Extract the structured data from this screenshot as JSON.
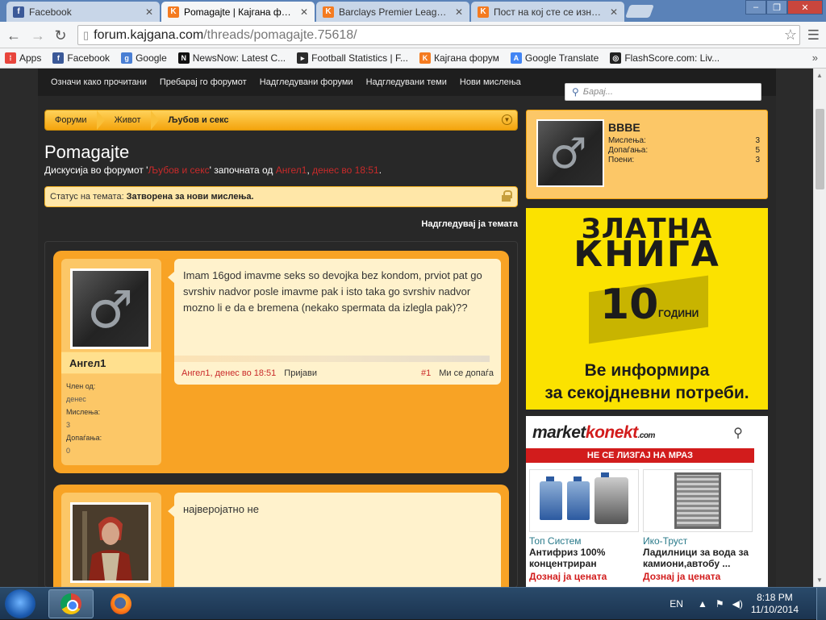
{
  "browser": {
    "tabs": [
      {
        "label": "Facebook",
        "icon": "facebook-icon",
        "color": "#3b5998",
        "glyph": "f"
      },
      {
        "label": "Pomagajte | Кајгана фору",
        "icon": "kajgana-icon",
        "color": "#f47b20",
        "glyph": "K"
      },
      {
        "label": "Barclays Premier League -",
        "icon": "kajgana-icon",
        "color": "#f47b20",
        "glyph": "K"
      },
      {
        "label": "Пост на кој сте се изнасм",
        "icon": "kajgana-icon",
        "color": "#f47b20",
        "glyph": "K"
      }
    ],
    "url_host": "forum.kajgana.com",
    "url_path": "/threads/pomagajte.75618/",
    "bookmarks": [
      {
        "label": "Apps",
        "icon": "apps-icon",
        "color": "#e8453c",
        "glyph": "⁞"
      },
      {
        "label": "Facebook",
        "icon": "facebook-icon",
        "color": "#3b5998",
        "glyph": "f"
      },
      {
        "label": "Google",
        "icon": "google-icon",
        "color": "#4a7fd4",
        "glyph": "g"
      },
      {
        "label": "NewsNow: Latest C...",
        "icon": "newsnow-icon",
        "color": "#111",
        "glyph": "N"
      },
      {
        "label": "Football Statistics | F...",
        "icon": "football-stats-icon",
        "color": "#2b2b2b",
        "glyph": "▸"
      },
      {
        "label": "Кајгана форум",
        "icon": "kajgana-icon",
        "color": "#f47b20",
        "glyph": "K"
      },
      {
        "label": "Google Translate",
        "icon": "translate-icon",
        "color": "#4285f4",
        "glyph": "A"
      },
      {
        "label": "FlashScore.com: Liv...",
        "icon": "flashscore-icon",
        "color": "#222",
        "glyph": "◎"
      }
    ],
    "bookmarks_more": "»"
  },
  "forum": {
    "nav": [
      "Означи како прочитани",
      "Пребарај го форумот",
      "Надгледувани форуми",
      "Надгледувани теми",
      "Нови мислења"
    ],
    "search_placeholder": "Барај...",
    "breadcrumbs": [
      "Форуми",
      "Живот",
      "Љубов и секс"
    ],
    "thread_title": "Pomagajte",
    "desc_pre": "Дискусија во форумот '",
    "desc_forum": "Љубов и секс",
    "desc_mid": "' започната од ",
    "desc_author": "Ангел1",
    "desc_comma": ", ",
    "desc_time": "денес во 18:51",
    "desc_end": ".",
    "status_label": "Статус на темата:",
    "status_value": "Затворена за нови мислења.",
    "watch_thread": "Надгледувај ја темата",
    "posts": [
      {
        "username": "Ангел1",
        "member_since_label": "Член од:",
        "member_since": "денес",
        "messages_label": "Мислења:",
        "messages": "3",
        "likes_label": "Допаѓања:",
        "likes": "0",
        "text": "Imam 16god imavme seks so devojka bez kondom, prviot pat go svrshiv nadvor posle imavme pak i isto taka go svrshiv nadvor mozno li e da e bremena (nekako spermata da izlegla pak)??",
        "byline": "Ангел1, денес во 18:51",
        "report": "Пријави",
        "number": "#1",
        "like": "Ми се допаѓа"
      },
      {
        "text": "највероjатно не"
      }
    ]
  },
  "sidebar": {
    "username": "BBBE",
    "stats": [
      {
        "label": "Мислења:",
        "value": "3"
      },
      {
        "label": "Допаѓања:",
        "value": "5"
      },
      {
        "label": "Поени:",
        "value": "3"
      }
    ]
  },
  "ad_book": {
    "line1": "ЗЛАТНА",
    "line2": "КНИГА",
    "years_num": "10",
    "years_word": "ГОДИНИ",
    "tag1": "Ве информира",
    "tag2": "за секојдневни потреби."
  },
  "ad_market": {
    "logo_market": "market",
    "logo_konekt": "konekt",
    "logo_com": ".com",
    "banner": "НЕ СЕ ЛИЗГАЈ НА МРАЗ",
    "products": [
      {
        "vendor": "Топ Систем",
        "name1": "Антифриз 100%",
        "name2": "концентриран",
        "price": "Дознај ја цената"
      },
      {
        "vendor": "Ико-Труст",
        "name1": "Ладилници за вода за",
        "name2": "камиони,автобу ...",
        "price": "Дознај ја цената"
      }
    ]
  },
  "taskbar": {
    "lang": "EN",
    "time": "8:18 PM",
    "date": "11/10/2014"
  }
}
